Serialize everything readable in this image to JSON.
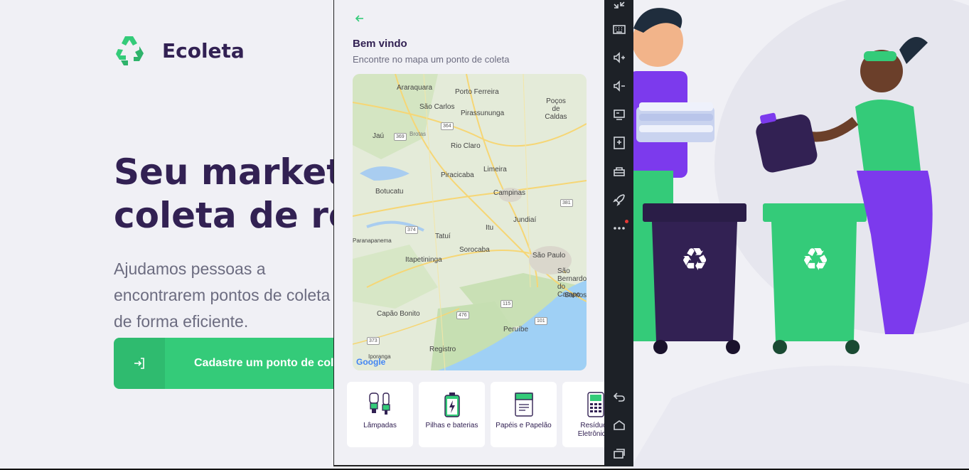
{
  "web": {
    "brand": "Ecoleta",
    "title_line1": "Seu marketplace",
    "title_line2": "coleta de resíduos",
    "description": "Ajudamos pessoas a encontrarem pontos de coleta de forma eficiente.",
    "cta_label": "Cadastre um ponto de coleta",
    "accent_color": "#34cb79",
    "title_color": "#322153"
  },
  "app": {
    "back_icon": "arrow-left-icon",
    "welcome": "Bem vindo",
    "subtitle": "Encontre no mapa um ponto de coleta",
    "map": {
      "attribution": "Google",
      "cities": [
        "Araraquara",
        "Porto Ferreira",
        "São Carlos",
        "Pirassununga",
        "Poços de Caldas",
        "Jaú",
        "Brotas",
        "Rio Claro",
        "Piracicaba",
        "Limeira",
        "Campinas",
        "Botucatu",
        "Jundiaí",
        "Itu",
        "Tatuí",
        "Sorocaba",
        "São Paulo",
        "Itapetininga",
        "São Bernardo do Campo",
        "Santos",
        "Capão Bonito",
        "Peruíbe",
        "Registro",
        "Iporanga",
        "Paranapanema"
      ],
      "road_shields": [
        "364",
        "369",
        "381",
        "374",
        "115",
        "476",
        "101",
        "373"
      ]
    },
    "items": [
      {
        "label": "Lâmpadas",
        "icon": "lamp-icon"
      },
      {
        "label": "Pilhas e baterias",
        "icon": "battery-icon"
      },
      {
        "label": "Papéis e Papelão",
        "icon": "paper-icon"
      },
      {
        "label": "Resíduos Eletrônicos",
        "icon": "electronics-icon"
      }
    ]
  },
  "emulator_toolbar": {
    "buttons": [
      "fullscreen-icon",
      "keyboard-icon",
      "volume-up-icon",
      "volume-down-icon",
      "screen-icon",
      "install-apk-icon",
      "toolbox-icon",
      "rocket-icon",
      "more-icon",
      "back-nav-icon",
      "home-nav-icon",
      "recents-nav-icon"
    ]
  }
}
